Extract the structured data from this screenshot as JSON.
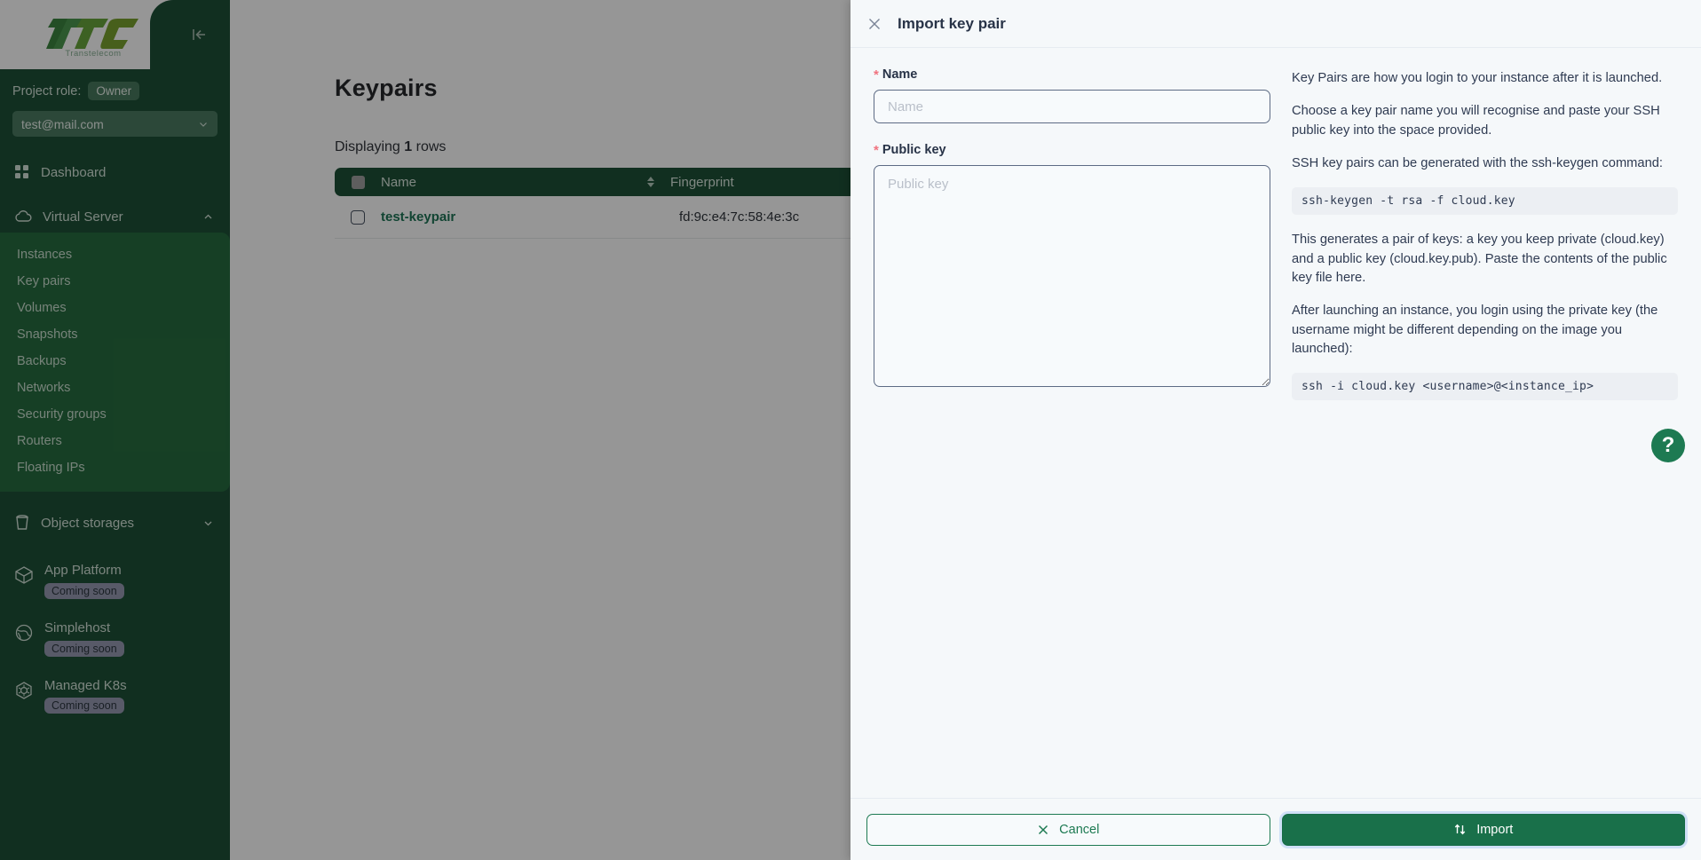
{
  "sidebar": {
    "logo": {
      "mark": "TTC",
      "subtitle": "Transtelecom",
      "icon": "ttc-logo-icon"
    },
    "collapse_icon": "collapse-sidebar-icon",
    "role_label": "Project role:",
    "role_value": "Owner",
    "project": {
      "value": "test@mail.com",
      "chevron": "chevron-down-icon"
    },
    "dashboard": {
      "label": "Dashboard",
      "icon": "grid-icon"
    },
    "virtual_server": {
      "label": "Virtual Server",
      "icon": "cloud-icon",
      "chevron": "chevron-up-icon"
    },
    "sub_items": [
      {
        "label": "Instances",
        "active": false
      },
      {
        "label": "Key pairs",
        "active": true
      },
      {
        "label": "Volumes",
        "active": false
      },
      {
        "label": "Snapshots",
        "active": false
      },
      {
        "label": "Backups",
        "active": false
      },
      {
        "label": "Networks",
        "active": false
      },
      {
        "label": "Security groups",
        "active": false
      },
      {
        "label": "Routers",
        "active": false
      },
      {
        "label": "Floating IPs",
        "active": false
      }
    ],
    "object_storages": {
      "label": "Object storages",
      "icon": "bucket-icon",
      "chevron": "chevron-down-icon"
    },
    "products": [
      {
        "label": "App Platform",
        "badge": "Coming soon",
        "icon": "cube-icon"
      },
      {
        "label": "Simplehost",
        "badge": "Coming soon",
        "icon": "globe-icon"
      },
      {
        "label": "Managed K8s",
        "badge": "Coming soon",
        "icon": "kubernetes-icon"
      }
    ]
  },
  "main": {
    "title": "Keypairs",
    "rows_prefix": "Displaying",
    "rows_count": "1",
    "rows_suffix": "rows",
    "columns": [
      "Name",
      "Fingerprint"
    ],
    "rows": [
      {
        "name": "test-keypair",
        "fingerprint": "fd:9c:e4:7c:58:4e:3c"
      }
    ]
  },
  "modal": {
    "title": "Import key pair",
    "close_icon": "close-icon",
    "form": {
      "name_label": "Name",
      "name_placeholder": "Name",
      "name_value": "",
      "public_key_label": "Public key",
      "public_key_placeholder": "Public key",
      "public_key_value": "",
      "required_marker": "*"
    },
    "help": {
      "paragraphs": [
        "Key Pairs are how you login to your instance after it is launched.",
        "Choose a key pair name you will recognise and paste your SSH public key into the space provided.",
        "SSH key pairs can be generated with the ssh-keygen command:"
      ],
      "code1": "ssh-keygen -t rsa -f cloud.key",
      "paragraphs2": [
        "This generates a pair of keys: a key you keep private (cloud.key) and a public key (cloud.key.pub). Paste the contents of the public key file here.",
        "After launching an instance, you login using the private key (the username might be different depending on the image you launched):"
      ],
      "code2": "ssh -i cloud.key <username>@<instance_ip>"
    },
    "footer": {
      "cancel_label": "Cancel",
      "cancel_icon": "close-icon",
      "import_label": "Import",
      "import_icon": "import-arrows-icon"
    }
  },
  "help_fab": {
    "label": "?",
    "icon": "question-mark-icon"
  },
  "colors": {
    "sidebar_bg": "#0d4429",
    "subnav_bg": "#176232",
    "accent_green": "#1d7a52",
    "table_header": "#0d4429",
    "required_red": "#f0737f",
    "modal_bg": "#f5f8fa"
  }
}
